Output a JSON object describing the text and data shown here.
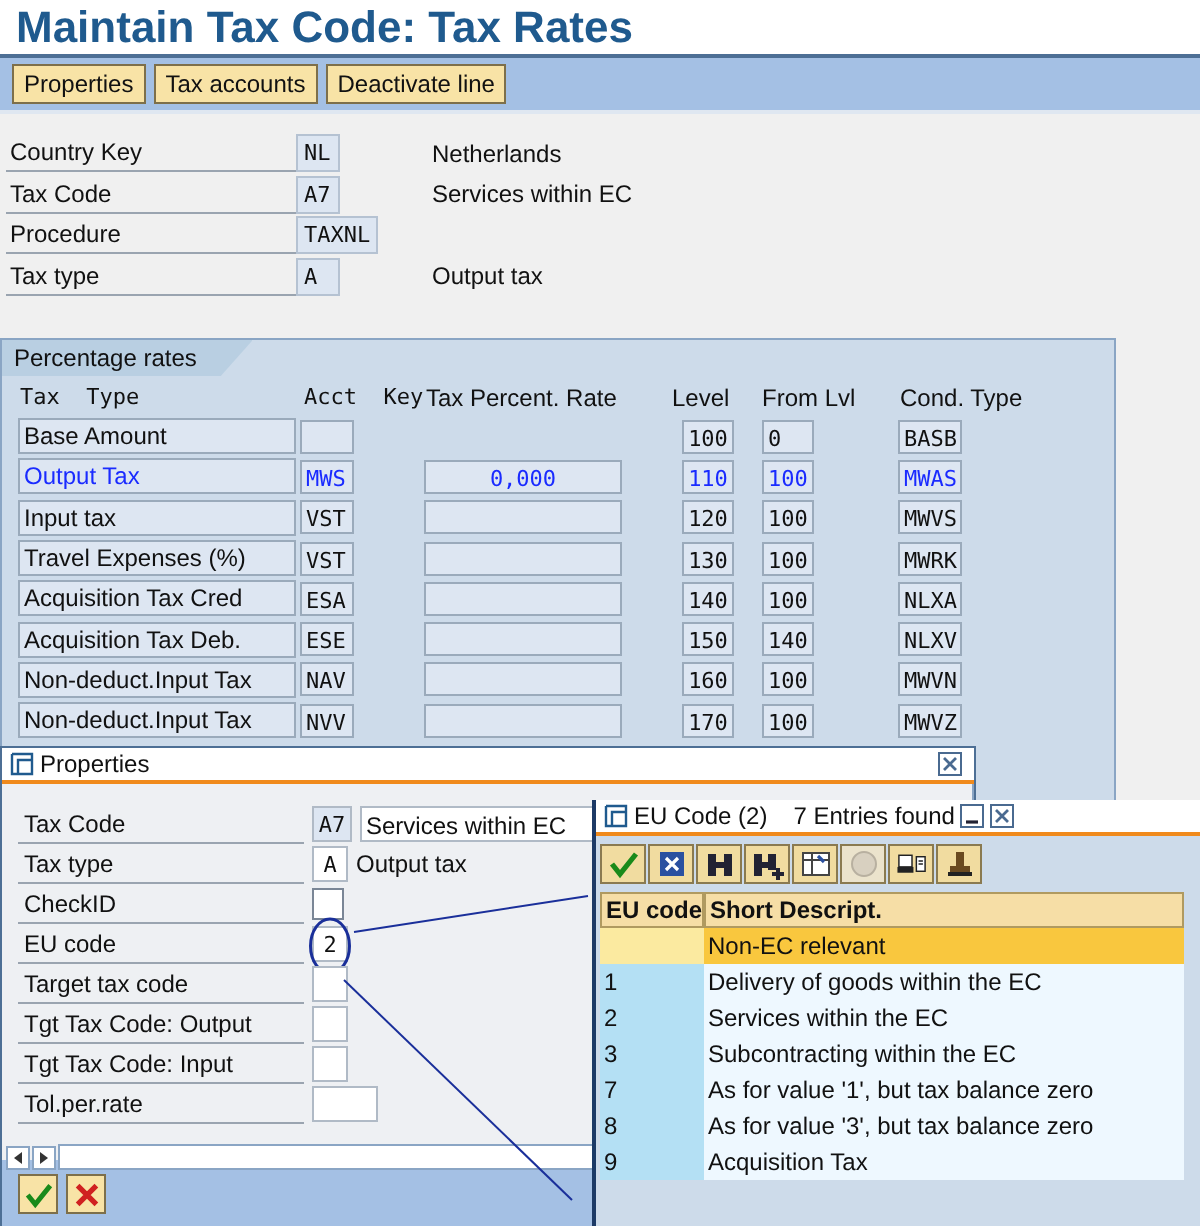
{
  "window": {
    "title": "Maintain Tax Code: Tax Rates"
  },
  "toolbar": [
    "Properties",
    "Tax accounts",
    "Deactivate line"
  ],
  "header_fields": [
    {
      "label": "Country Key",
      "value": "NL",
      "description": "Netherlands"
    },
    {
      "label": "Tax Code",
      "value": "A7",
      "description": "Services within EC"
    },
    {
      "label": "Procedure",
      "value": "TAXNL"
    },
    {
      "label": "Tax type",
      "value": "A",
      "description": "Output tax"
    }
  ],
  "percentage_rates": {
    "title": "Percentage rates",
    "columns": [
      "Tax  Type",
      "Acct  Key",
      "Tax Percent. Rate",
      "Level",
      "From Lvl",
      "Cond. Type"
    ],
    "rows": [
      {
        "tax_type": "Base Amount",
        "rate_field": false,
        "level": "100",
        "from_lvl": "0",
        "cond_type": "BASB",
        "selected": false
      },
      {
        "tax_type": "Output Tax",
        "acct_key": "MWS",
        "rate_field": true,
        "rate": "0,000",
        "level": "110",
        "from_lvl": "100",
        "cond_type": "MWAS",
        "selected": true
      },
      {
        "tax_type": "Input tax",
        "acct_key": "VST",
        "rate_field": true,
        "level": "120",
        "from_lvl": "100",
        "cond_type": "MWVS",
        "selected": false
      },
      {
        "tax_type": "Travel Expenses (%)",
        "acct_key": "VST",
        "rate_field": true,
        "level": "130",
        "from_lvl": "100",
        "cond_type": "MWRK",
        "selected": false
      },
      {
        "tax_type": "Acquisition Tax Cred",
        "acct_key": "ESA",
        "rate_field": true,
        "level": "140",
        "from_lvl": "100",
        "cond_type": "NLXA",
        "selected": false
      },
      {
        "tax_type": "Acquisition Tax Deb.",
        "acct_key": "ESE",
        "rate_field": true,
        "level": "150",
        "from_lvl": "140",
        "cond_type": "NLXV",
        "selected": false
      },
      {
        "tax_type": "Non-deduct.Input Tax",
        "acct_key": "NAV",
        "rate_field": true,
        "level": "160",
        "from_lvl": "100",
        "cond_type": "MWVN",
        "selected": false
      },
      {
        "tax_type": "Non-deduct.Input Tax",
        "acct_key": "NVV",
        "rate_field": true,
        "level": "170",
        "from_lvl": "100",
        "cond_type": "MWVZ",
        "selected": false
      }
    ]
  },
  "properties_dialog": {
    "title": "Properties",
    "fields": [
      {
        "label": "Tax Code",
        "kind": "text",
        "value": "A7",
        "description": "Services within EC",
        "description_boxed": true,
        "highlighted": false
      },
      {
        "label": "Tax type",
        "kind": "text",
        "value": "A",
        "description": "Output tax",
        "description_boxed": false,
        "highlighted": false
      },
      {
        "label": "CheckID",
        "kind": "checkbox",
        "checked": false
      },
      {
        "label": "EU code",
        "kind": "text",
        "value": "2",
        "highlighted": true
      },
      {
        "label": "Target tax code",
        "kind": "text",
        "highlighted": false
      },
      {
        "label": "Tgt Tax Code: Output",
        "kind": "text",
        "highlighted": false
      },
      {
        "label": "Tgt Tax Code: Input",
        "kind": "text",
        "highlighted": false
      },
      {
        "label": "Tol.per.rate",
        "kind": "percent",
        "highlighted": false
      }
    ]
  },
  "eu_code_popup": {
    "title": "EU Code (2)",
    "status": "7 Entries found",
    "columns": [
      "EU code",
      "Short Descript."
    ],
    "rows": [
      {
        "description": "Non-EC relevant",
        "selected": true
      },
      {
        "code": "1",
        "description": "Delivery of goods within the EC",
        "selected": false
      },
      {
        "code": "2",
        "description": "Services within the EC",
        "selected": false
      },
      {
        "code": "3",
        "description": "Subcontracting within the EC",
        "selected": false
      },
      {
        "code": "7",
        "description": "As for value '1', but tax balance zero",
        "selected": false
      },
      {
        "code": "8",
        "description": "As for value '3', but tax balance zero",
        "selected": false
      },
      {
        "code": "9",
        "description": "Acquisition Tax",
        "selected": false
      }
    ]
  }
}
